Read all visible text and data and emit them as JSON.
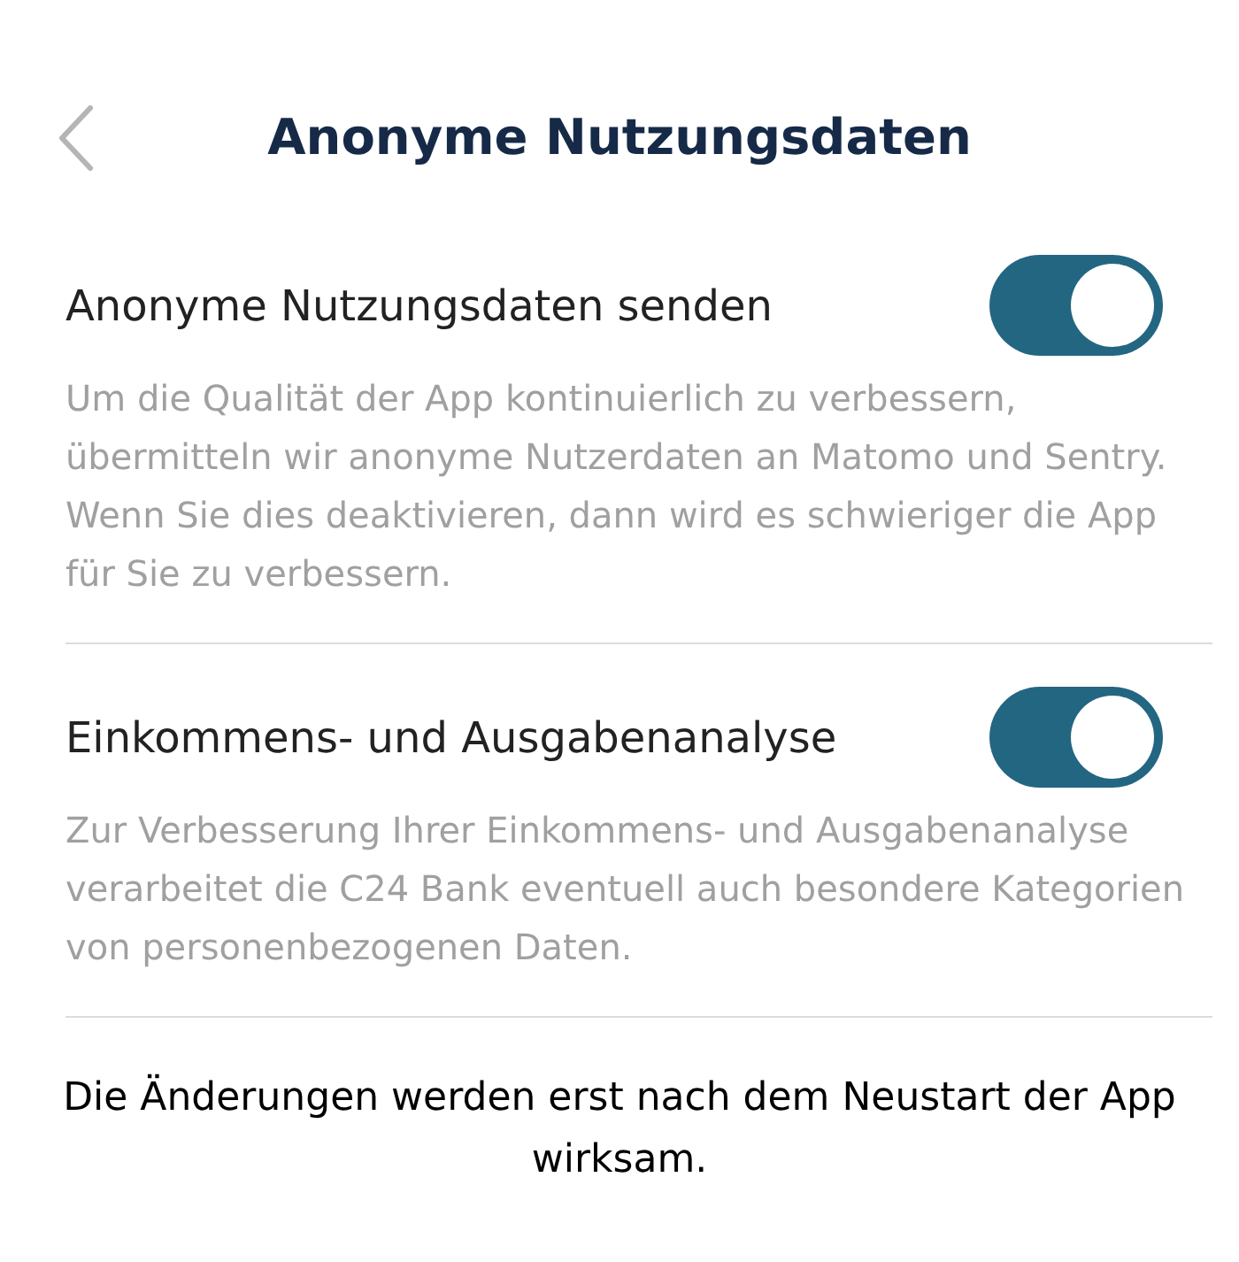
{
  "header": {
    "title": "Anonyme Nutzungsdaten"
  },
  "settings": [
    {
      "label": "Anonyme Nutzungsdaten senden",
      "on": true,
      "description": "Um die Qualität der App kontinuierlich zu verbessern, übermitteln wir anonyme Nutzerdaten an Matomo und Sentry. Wenn Sie dies deaktivieren, dann wird es schwieriger die App für Sie zu verbessern."
    },
    {
      "label": "Einkommens- und Ausgabenanalyse",
      "on": true,
      "description": "Zur Verbesserung Ihrer Einkommens- und Ausgabenanalyse verarbeitet die C24 Bank eventuell auch besondere Kategorien von personenbezogenen Daten."
    }
  ],
  "footer_note": "Die Änderungen werden erst nach dem Neustart der App wirksam."
}
